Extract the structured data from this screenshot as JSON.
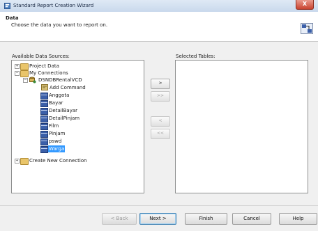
{
  "window": {
    "title": "Standard Report Creation Wizard",
    "close_label": "X"
  },
  "header": {
    "title": "Data",
    "subtitle": "Choose the data you want to report on."
  },
  "labels": {
    "available": "Available Data Sources:",
    "selected": "Selected Tables:"
  },
  "tree": {
    "project_data": "Project Data",
    "my_connections": "My Connections",
    "connection": "DSNDBRentalVCD",
    "add_command": "Add Command",
    "tables": [
      "Anggota",
      "Bayar",
      "DetailBayar",
      "DetailPinjam",
      "Film",
      "Pinjam",
      "pswd",
      "Warga"
    ],
    "selected_table": "Warga",
    "create_new": "Create New Connection"
  },
  "move_buttons": {
    "add": ">",
    "add_all": ">>",
    "remove": "<",
    "remove_all": "<<"
  },
  "footer": {
    "back": "< Back",
    "next": "Next >",
    "finish": "Finish",
    "cancel": "Cancel",
    "help": "Help"
  },
  "colors": {
    "selection": "#3399ff",
    "folder": "#e9c56a",
    "table_icon": "#3b5fa8"
  }
}
